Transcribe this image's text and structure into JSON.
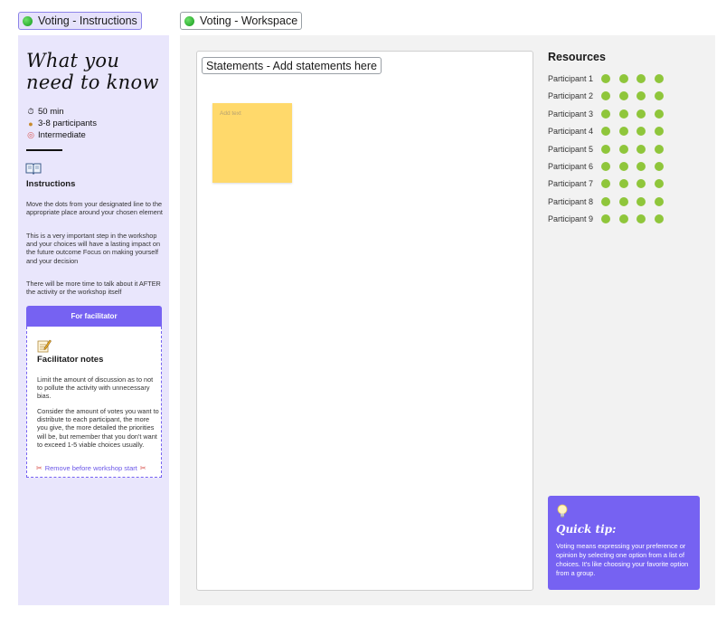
{
  "frames": {
    "instructions_tab": "Voting - Instructions",
    "workspace_tab": "Voting - Workspace",
    "statements_tab": "Statements - Add statements here"
  },
  "instructions": {
    "title_line1": "What you",
    "title_line2": "need to know",
    "duration": "50 min",
    "participants": "3-8 participants",
    "level": "Intermediate",
    "section_title": "Instructions",
    "paragraphs": [
      "Move the dots from your designated line to the appropriate place around your chosen element",
      "This is a very important step in the workshop and your choices will have a lasting impact on the future outcome Focus on making yourself and your decision",
      "There will be more time to talk about it AFTER the activity or the workshop itself"
    ]
  },
  "facilitator": {
    "header": "For facilitator",
    "title": "Facilitator notes",
    "paragraphs": [
      "Limit the amount of discussion  as to not to pollute the activity with unnecessary bias.",
      "Consider the amount of votes you want to distribute  to  each participant, the  more you give, the more detailed the priorities  will be, but remember that you don't want to exceed 1-5 viable choices usually."
    ],
    "remove_note": "Remove before workshop start"
  },
  "sticky": {
    "placeholder": "Add text"
  },
  "resources": {
    "title": "Resources",
    "participants": [
      "Participant 1",
      "Participant 2",
      "Participant 3",
      "Participant 4",
      "Participant 5",
      "Participant 6",
      "Participant 7",
      "Participant 8",
      "Participant 9"
    ],
    "dots_per_participant": 4,
    "dot_color": "#8fc63b"
  },
  "tip": {
    "title": "Quick tip:",
    "text": "Voting means expressing your preference or opinion by selecting one option from a list of choices. It's like choosing your favorite option from a group."
  },
  "colors": {
    "accent": "#7662f2",
    "instructions_bg": "#e9e6fc",
    "workspace_bg": "#f2f2f2",
    "sticky": "#ffd96b"
  }
}
